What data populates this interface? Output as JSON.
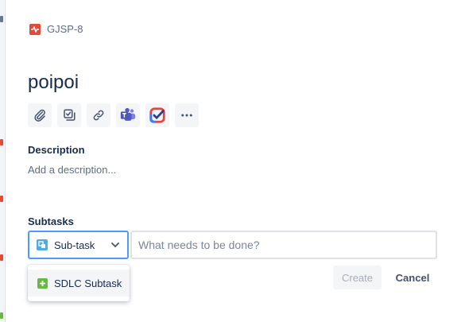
{
  "issue": {
    "key": "GJSP-8",
    "title": "poipoi"
  },
  "toolbar": {
    "buttons": [
      {
        "name": "attach",
        "icon": "paperclip-icon"
      },
      {
        "name": "add-subtask",
        "icon": "checkbox-tree-icon"
      },
      {
        "name": "link-issue",
        "icon": "link-icon"
      },
      {
        "name": "teams",
        "icon": "microsoft-teams-icon"
      },
      {
        "name": "checklist",
        "icon": "checklist-app-icon"
      },
      {
        "name": "more",
        "icon": "more-icon"
      }
    ]
  },
  "description": {
    "label": "Description",
    "placeholder": "Add a description..."
  },
  "subtasks": {
    "label": "Subtasks",
    "type_selected": "Sub-task",
    "input_placeholder": "What needs to be done?",
    "input_value": "",
    "type_options": [
      "SDLC Subtask"
    ],
    "create_label": "Create",
    "cancel_label": "Cancel"
  },
  "colors": {
    "accent": "#4c9aff",
    "bug": "#e5493a",
    "subtask": "#4bade8",
    "sdlc": "#65ba43",
    "text": "#172b4d",
    "muted": "#5e6c84",
    "disabled_text": "#a5adba"
  }
}
